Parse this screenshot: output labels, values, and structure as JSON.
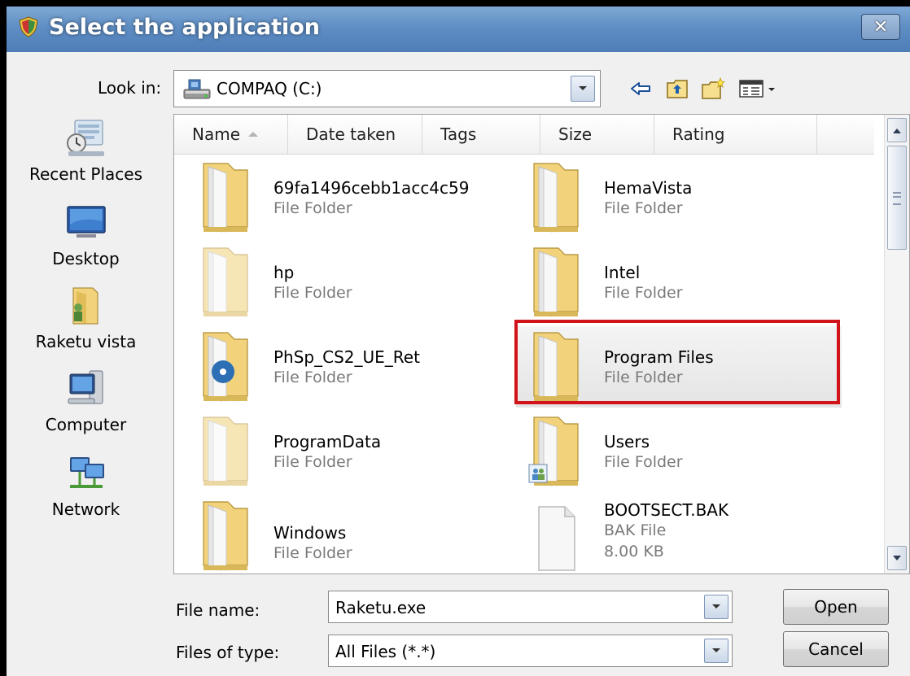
{
  "window": {
    "title": "Select the application"
  },
  "lookin": {
    "label": "Look in:",
    "value": "COMPAQ (C:)"
  },
  "places": [
    {
      "label": "Recent Places",
      "icon": "recent-places-icon"
    },
    {
      "label": "Desktop",
      "icon": "desktop-icon"
    },
    {
      "label": "Raketu vista",
      "icon": "user-folder-icon"
    },
    {
      "label": "Computer",
      "icon": "computer-icon"
    },
    {
      "label": "Network",
      "icon": "network-icon"
    }
  ],
  "columns": [
    "Name",
    "Date taken",
    "Tags",
    "Size",
    "Rating"
  ],
  "files": [
    {
      "name": "69fa1496cebb1acc4c59",
      "type": "File Folder"
    },
    {
      "name": "HemaVista",
      "type": "File Folder"
    },
    {
      "name": "hp",
      "type": "File Folder"
    },
    {
      "name": "Intel",
      "type": "File Folder"
    },
    {
      "name": "PhSp_CS2_UE_Ret",
      "type": "File Folder"
    },
    {
      "name": "Program Files",
      "type": "File Folder"
    },
    {
      "name": "ProgramData",
      "type": "File Folder"
    },
    {
      "name": "Users",
      "type": "File Folder"
    },
    {
      "name": "Windows",
      "type": "File Folder"
    },
    {
      "name": "BOOTSECT.BAK",
      "type": "BAK File",
      "size": "8.00 KB"
    }
  ],
  "filename": {
    "label": "File name:",
    "value": "Raketu.exe"
  },
  "filetype": {
    "label": "Files of type:",
    "value": "All Files (*.*)"
  },
  "buttons": {
    "open": "Open",
    "cancel": "Cancel"
  },
  "colors": {
    "titlebar": "#5f8ec4",
    "highlight": "#d0141a",
    "folder": "#f2d27a"
  }
}
